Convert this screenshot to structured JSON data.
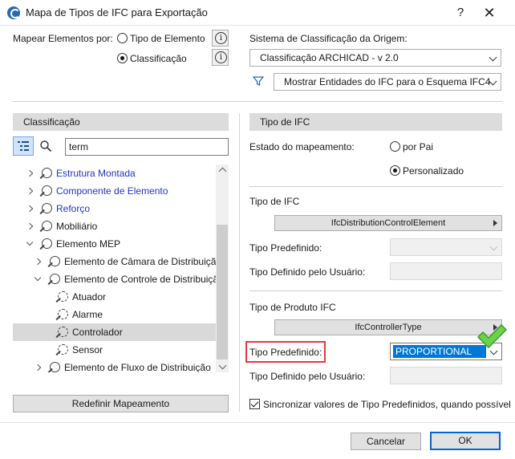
{
  "window": {
    "title": "Mapa de Tipos de IFC para Exportação",
    "help_glyph": "?",
    "close_glyph": "✕"
  },
  "mapping": {
    "label": "Mapear Elementos por:",
    "options": [
      {
        "label": "Tipo de Elemento",
        "selected": false
      },
      {
        "label": "Classificação",
        "selected": true
      }
    ]
  },
  "source_system": {
    "label": "Sistema de Classificação da Origem:",
    "value": "Classificação ARCHICAD - v 2.0",
    "filter_value": "Mostrar Entidades do IFC para o Esquema IFC4"
  },
  "left_panel": {
    "header": "Classificação",
    "search_value": "term",
    "tree": [
      {
        "label": "Estrutura Montada",
        "expanded": false,
        "color": "blue",
        "selected": false
      },
      {
        "label": "Componente de Elemento",
        "expanded": false,
        "color": "blue",
        "selected": false
      },
      {
        "label": "Reforço",
        "expanded": false,
        "color": "blue",
        "selected": false
      },
      {
        "label": "Mobiliário",
        "expanded": false,
        "color": "default",
        "selected": false
      },
      {
        "label": "Elemento MEP",
        "expanded": true,
        "color": "default",
        "selected": false
      },
      {
        "label": "Elemento de Câmara de Distribuição",
        "expanded": false,
        "color": "default",
        "selected": false
      },
      {
        "label": "Elemento de Controle de Distribuição",
        "expanded": true,
        "color": "default",
        "selected": false
      },
      {
        "label": "Atuador",
        "expanded": null,
        "color": "default",
        "selected": false
      },
      {
        "label": "Alarme",
        "expanded": null,
        "color": "default",
        "selected": false
      },
      {
        "label": "Controlador",
        "expanded": null,
        "color": "default",
        "selected": true
      },
      {
        "label": "Sensor",
        "expanded": null,
        "color": "default",
        "selected": false
      },
      {
        "label": "Elemento de Fluxo de Distribuição",
        "expanded": false,
        "color": "default",
        "selected": false
      }
    ],
    "reset_button": "Redefinir Mapeamento"
  },
  "right_panel": {
    "header": "Tipo de IFC",
    "mapping_status": {
      "label": "Estado do mapeamento:",
      "options": [
        {
          "label": "por Pai",
          "selected": false
        },
        {
          "label": "Personalizado",
          "selected": true
        }
      ]
    },
    "ifc_type": {
      "label": "Tipo de IFC",
      "value": "IfcDistributionControlElement",
      "predefined_label": "Tipo Predefinido:",
      "predefined_value": "",
      "user_defined_label": "Tipo Definido pelo Usuário:",
      "user_defined_value": ""
    },
    "product_type": {
      "label": "Tipo de Produto IFC",
      "value": "IfcControllerType",
      "predefined_label": "Tipo Predefinido:",
      "predefined_value": "PROPORTIONAL",
      "user_defined_label": "Tipo Definido pelo Usuário:",
      "user_defined_value": ""
    },
    "sync_checkbox": {
      "label": "Sincronizar valores de Tipo Predefinidos, quando possível",
      "checked": true
    }
  },
  "footer": {
    "cancel": "Cancelar",
    "ok": "OK"
  },
  "colors": {
    "accent": "#0a64c8",
    "highlight": "#e53a3a",
    "link": "#1f35c6",
    "selection": "#0078d7",
    "check": "#3fb53a"
  }
}
